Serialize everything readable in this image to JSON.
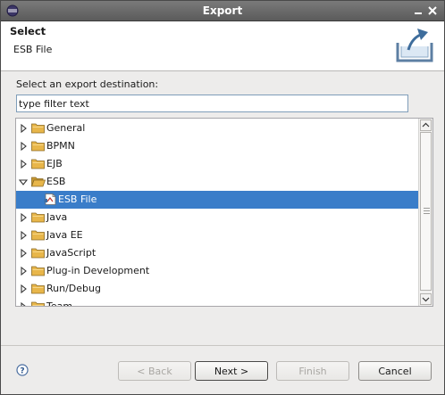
{
  "window": {
    "title": "Export"
  },
  "header": {
    "title": "Select",
    "subtitle": "ESB File"
  },
  "filter": {
    "label": "Select an export destination:",
    "value": "type filter text"
  },
  "tree": {
    "items": [
      {
        "label": "General",
        "expanded": false,
        "depth": 0,
        "selected": false
      },
      {
        "label": "BPMN",
        "expanded": false,
        "depth": 0,
        "selected": false
      },
      {
        "label": "EJB",
        "expanded": false,
        "depth": 0,
        "selected": false
      },
      {
        "label": "ESB",
        "expanded": true,
        "depth": 0,
        "selected": false
      },
      {
        "label": "ESB File",
        "expanded": false,
        "depth": 1,
        "selected": true
      },
      {
        "label": "Java",
        "expanded": false,
        "depth": 0,
        "selected": false
      },
      {
        "label": "Java EE",
        "expanded": false,
        "depth": 0,
        "selected": false
      },
      {
        "label": "JavaScript",
        "expanded": false,
        "depth": 0,
        "selected": false
      },
      {
        "label": "Plug-in Development",
        "expanded": false,
        "depth": 0,
        "selected": false
      },
      {
        "label": "Run/Debug",
        "expanded": false,
        "depth": 0,
        "selected": false
      },
      {
        "label": "Team",
        "expanded": false,
        "depth": 0,
        "selected": false
      }
    ]
  },
  "buttons": {
    "back": "< Back",
    "next": "Next >",
    "finish": "Finish",
    "cancel": "Cancel"
  },
  "colors": {
    "selection": "#3a7dc9",
    "folder": "#e8b64a"
  }
}
